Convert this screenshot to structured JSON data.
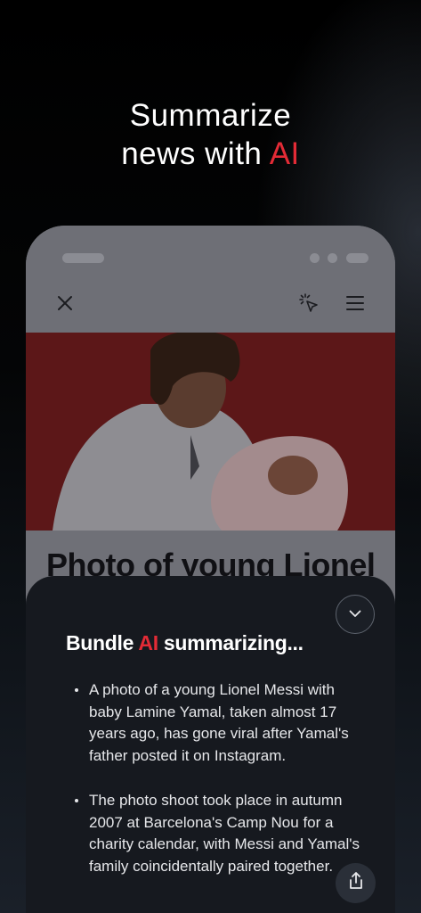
{
  "promo": {
    "headline_line1": "Summarize",
    "headline_line2_prefix": "news with ",
    "headline_line2_accent": "AI"
  },
  "browser": {
    "icons": {
      "close": "close-icon",
      "ai_cursor": "cursor-click-icon",
      "menu": "menu-icon"
    },
    "article_title": "Photo of young Lionel"
  },
  "summary": {
    "title_prefix": "Bundle ",
    "title_accent": "AI",
    "title_suffix": " summarizing...",
    "bullets": [
      "A photo of a young Lionel Messi with baby Lamine Yamal, taken almost 17 years ago, has gone viral after Yamal's father posted it on Instagram.",
      "The photo shoot took place in autumn 2007 at Barcelona's Camp Nou for a charity calendar, with Messi and Yamal's family coincidentally paired together."
    ],
    "icons": {
      "collapse": "chevron-down-icon",
      "share": "share-icon"
    }
  },
  "colors": {
    "accent": "#e32b36",
    "sheet_bg": "#16191f",
    "photo_bg": "#5b1719"
  }
}
